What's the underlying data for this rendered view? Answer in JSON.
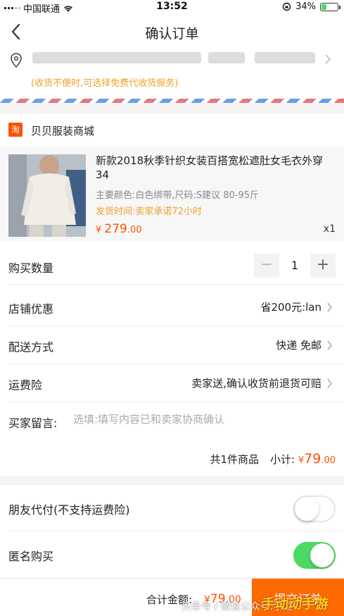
{
  "status_bar": {
    "carrier": "中国联通",
    "time": "13:52",
    "battery": "34%",
    "battery_level": 0.34
  },
  "nav": {
    "title": "确认订单"
  },
  "address": {
    "note": "(收货不便时,可选择免费代收货服务)"
  },
  "shop": {
    "icon_text": "淘",
    "name": "贝贝服装商城"
  },
  "product": {
    "title": "新款2018秋季针织女装百搭宽松遮肚女毛衣外穿34",
    "spec": "主要颜色:白色绑带,尺码:S建议 80-95斤",
    "ship": "发货时间:卖家承诺72小时",
    "price_symbol": "¥",
    "price_int": "279",
    "price_dec": ".00",
    "qty": "x1"
  },
  "order": {
    "quantity_label": "购买数量",
    "quantity_value": "1",
    "minus": "−",
    "plus": "+",
    "discount_label": "店铺优惠",
    "discount_value": "省200元:lan",
    "delivery_label": "配送方式",
    "delivery_value": "快递 免邮",
    "insurance_label": "运费险",
    "insurance_value": "卖家送,确认收货前退货可赔",
    "message_label": "买家留言:",
    "message_placeholder": "选填:填写内容已和卖家协商确认",
    "item_count": "共1件商品",
    "subtotal_label": "小计:",
    "subtotal_symbol": "¥",
    "subtotal_int": "79",
    "subtotal_dec": ".00"
  },
  "options": {
    "friend_pay_label": "朋友代付(不支持运费险)",
    "friend_pay_on": false,
    "anonymous_label": "匿名购买",
    "anonymous_on": true
  },
  "footer": {
    "total_label": "合计金额:",
    "total_symbol": "¥",
    "total_int": "79",
    "total_dec": ".00",
    "submit_label": "提交订单"
  },
  "watermark": {
    "text": "头条号 / 微信公众号:手游",
    "logo": "手动动手游"
  },
  "colors": {
    "accent": "#ff5000",
    "warning": "#f0a028",
    "toggle_on": "#4cd964",
    "submit": "#ff6a00"
  }
}
